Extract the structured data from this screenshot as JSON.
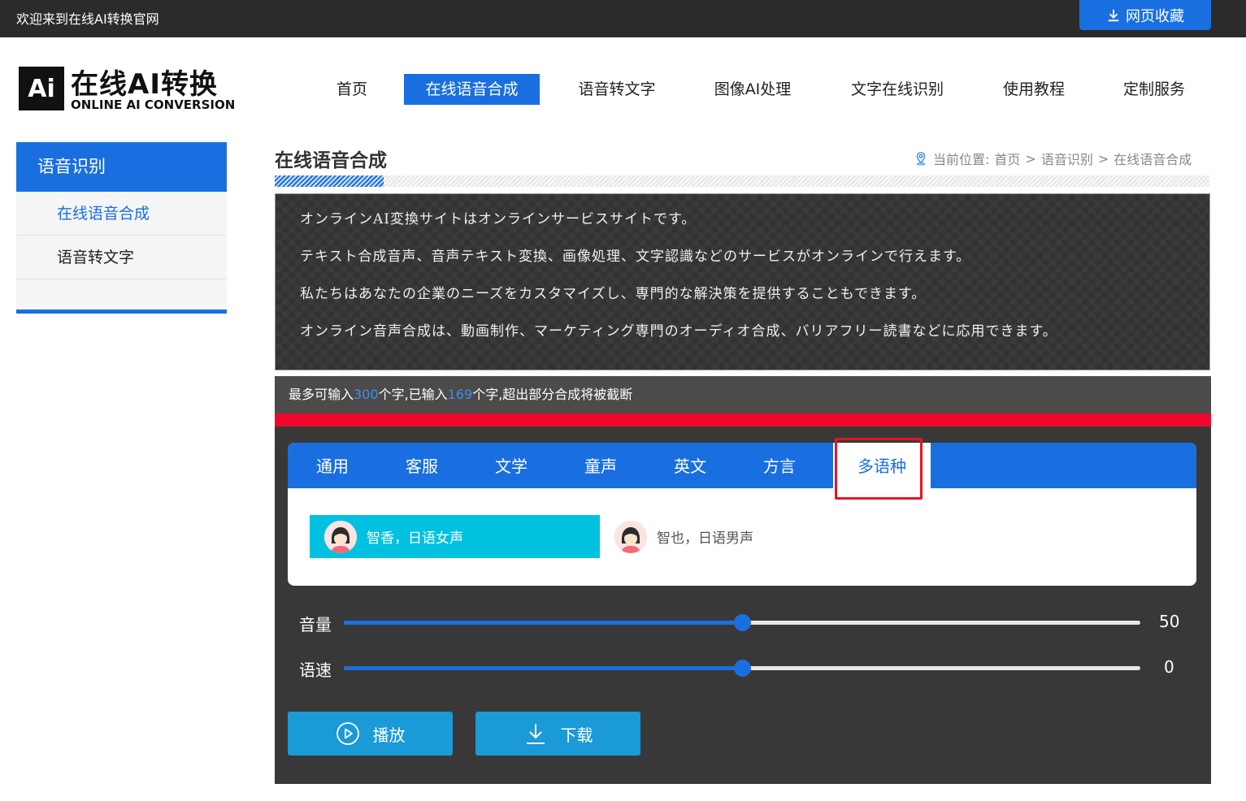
{
  "topbar": {
    "welcome": "欢迎来到在线AI转换官网",
    "bookmark_label": "网页收藏"
  },
  "logo": {
    "mark": "Ai",
    "cn": "在线AI转换",
    "en": "ONLINE AI CONVERSION"
  },
  "nav": {
    "items": [
      {
        "label": "首页"
      },
      {
        "label": "在线语音合成",
        "active": true
      },
      {
        "label": "语音转文字"
      },
      {
        "label": "图像AI处理"
      },
      {
        "label": "文字在线识别"
      },
      {
        "label": "使用教程"
      },
      {
        "label": "定制服务"
      }
    ]
  },
  "sidebar": {
    "heading": "语音识别",
    "items": [
      {
        "label": "在线语音合成",
        "current": true
      },
      {
        "label": "语音转文字"
      }
    ]
  },
  "main": {
    "title": "在线语音合成",
    "breadcrumb": {
      "prefix": "当前位置:",
      "parts": [
        "首页",
        "语音识别",
        "在线语音合成"
      ],
      "sep": ">"
    },
    "text_lines": [
      "オンラインAI変換サイトはオンラインサービスサイトです。",
      "テキスト合成音声、音声テキスト変換、画像処理、文字認識などのサービスがオンラインで行えます。",
      "私たちはあなたの企業のニーズをカスタマイズし、専門的な解決策を提供することもできます。",
      "オンライン音声合成は、動画制作、マーケティング専門のオーディオ合成、バリアフリー読書などに応用できます。"
    ],
    "counter": {
      "t1": "最多可输入",
      "max": "300",
      "t2": "个字,已输入",
      "current": "169",
      "t3": "个字,超出部分合成将被截断"
    }
  },
  "voice_tabs": [
    {
      "label": "通用"
    },
    {
      "label": "客服"
    },
    {
      "label": "文学"
    },
    {
      "label": "童声"
    },
    {
      "label": "英文"
    },
    {
      "label": "方言"
    },
    {
      "label": "多语种",
      "active": true
    }
  ],
  "voices": [
    {
      "label": "智香，日语女声",
      "selected": true
    },
    {
      "label": "智也，日语男声"
    }
  ],
  "controls": {
    "volume": {
      "label": "音量",
      "value": "50",
      "fraction": 0.5
    },
    "speed": {
      "label": "语速",
      "value": "0",
      "fraction": 0.5
    }
  },
  "buttons": {
    "play": "播放",
    "download": "下载"
  },
  "colors": {
    "accent": "#1a6fe0",
    "selected_voice": "#00c2e0",
    "alert_bar": "#f0082c",
    "highlight": "#e8141e"
  }
}
